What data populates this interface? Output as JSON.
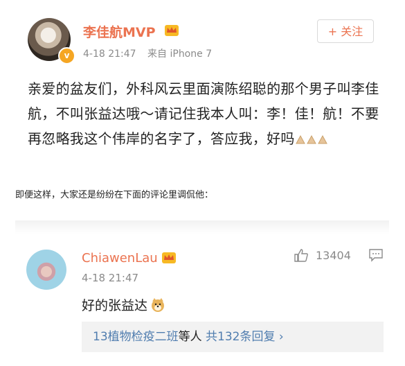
{
  "post": {
    "username": "李佳航MVP",
    "time": "4-18 21:47",
    "source": "来自 iPhone 7",
    "follow_label": "+ 关注",
    "verified_mark": "v",
    "text": "亲爱的盆友们，外科风云里面演陈绍聪的那个男子叫李佳航，不叫张益达哦～请记住我本人叫：李！佳！航！不要再忽略我这个伟岸的名字了，答应我，好吗",
    "emoji_count": 3
  },
  "caption": "即便这样，大家还是纷纷在下面的评论里调侃他：",
  "comment": {
    "username": "ChiawenLau",
    "time": "4-18 21:47",
    "like_count": "13404",
    "text": "好的张益达",
    "reply_summary": {
      "group": "13植物检疫二班",
      "middle": "等人",
      "total": "共132条回复 ›"
    }
  },
  "colors": {
    "username": "#eb7350",
    "link": "#507daf",
    "meta": "#8a8a8a"
  },
  "icons": [
    "crown-icon",
    "verified-icon",
    "like-icon",
    "reply-icon",
    "clap-emoji-icon",
    "doge-emoji-icon"
  ]
}
